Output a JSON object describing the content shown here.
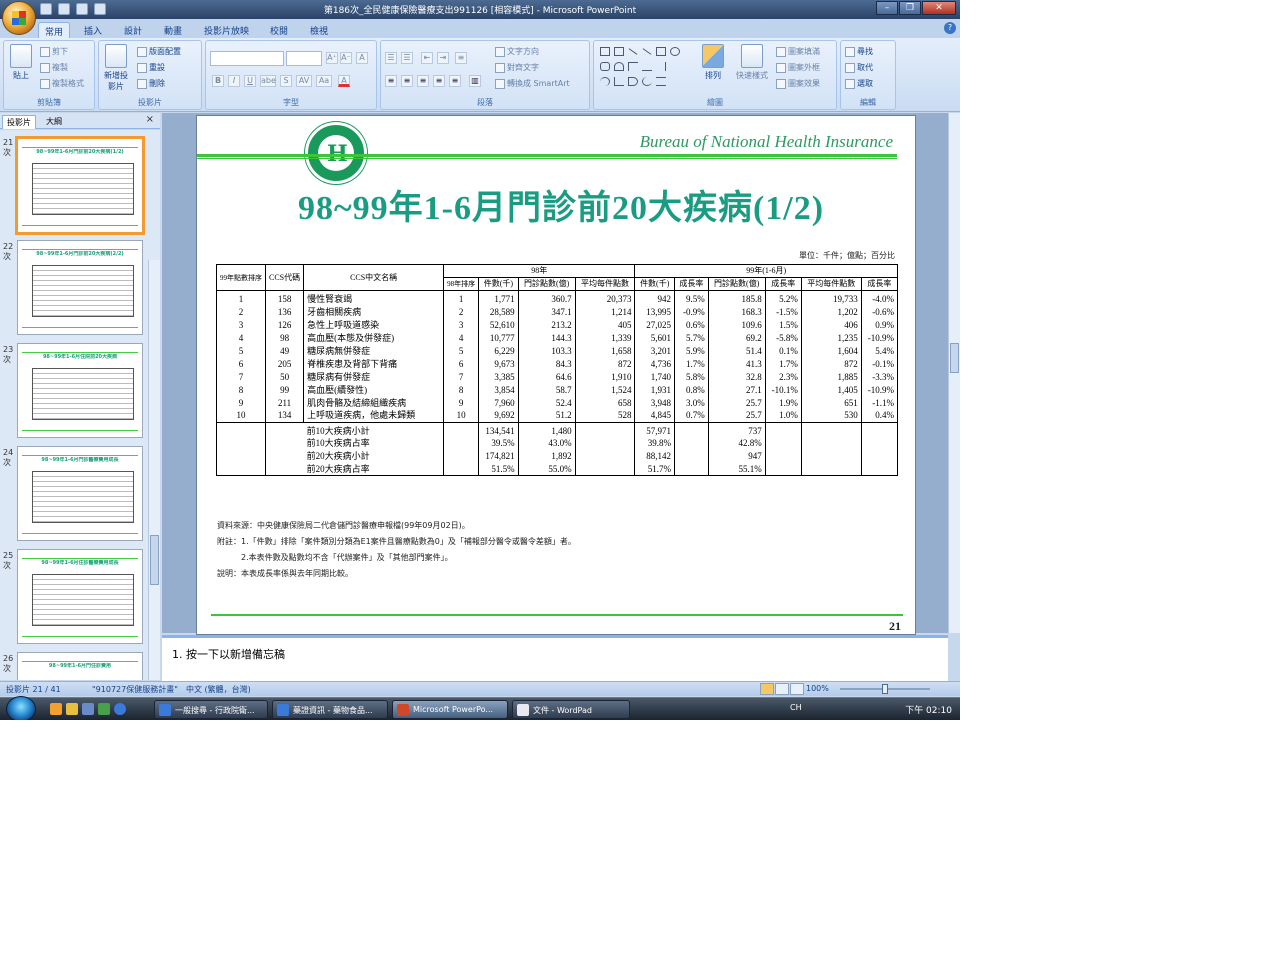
{
  "window": {
    "title": "第186次_全民健康保險醫療支出991126 [相容模式] - Microsoft PowerPoint"
  },
  "ribbon": {
    "tabs": [
      "常用",
      "插入",
      "設計",
      "動畫",
      "投影片放映",
      "校閱",
      "檢視"
    ],
    "active_tab": "常用",
    "clipboard": {
      "label": "剪貼簿",
      "paste": "貼上",
      "cut": "剪下",
      "copy": "複製",
      "format_painter": "複製格式"
    },
    "slides": {
      "label": "投影片",
      "new_slide": "新增投影片",
      "layout": "版面配置",
      "reset": "重設",
      "delete": "刪除"
    },
    "font": {
      "label": "字型",
      "bold": "B",
      "italic": "I",
      "underline": "U",
      "strike": "abe",
      "shadow": "S",
      "spacing": "AV",
      "case": "Aa",
      "grow": "A⁺",
      "shrink": "A⁻",
      "clear": "A"
    },
    "paragraph": {
      "label": "段落",
      "text_direction": "文字方向",
      "align_text": "對齊文字",
      "smartart": "轉換成 SmartArt"
    },
    "drawing": {
      "label": "繪圖",
      "arrange": "排列",
      "quick_styles": "快速樣式",
      "fill": "圖案填滿",
      "outline": "圖案外框",
      "effects": "圖案效果"
    },
    "editing": {
      "label": "編輯",
      "find": "尋找",
      "replace": "取代",
      "select": "選取"
    }
  },
  "left_pane": {
    "tabs": [
      "投影片",
      "大綱"
    ],
    "active_tab": "投影片",
    "close": "×",
    "suffix": "次",
    "thumbnails": [
      {
        "num": "21",
        "title": "98~99年1-6月門診前20大疾病(1/2)",
        "selected": true
      },
      {
        "num": "22",
        "title": "98~99年1-6月門診前20大疾病(2/2)",
        "selected": false
      },
      {
        "num": "23",
        "title": "98~99年1-6月住院前20大疾病",
        "selected": false
      },
      {
        "num": "24",
        "title": "98~99年1-6月門診醫療費用成長",
        "selected": false
      },
      {
        "num": "25",
        "title": "98~99年1-6月住診醫療費用成長",
        "selected": false
      },
      {
        "num": "26",
        "title": "98~99年1-6月門住診費用",
        "selected": false
      }
    ]
  },
  "slide": {
    "bureau": "Bureau of National Health Insurance",
    "title": "98~99年1-6月門診前20大疾病(1/2)",
    "unit": "單位：千件；億點；百分比",
    "number": "21",
    "headers": {
      "rank99": "99年點數排序",
      "ccs_code": "CCS代碼",
      "ccs_name": "CCS中文名稱",
      "y98": "98年",
      "y99": "99年(1-6月)",
      "rank98": "98年排序",
      "cases": "件數(千)",
      "points": "門診點數(億)",
      "avg": "平均每件點數",
      "growth": "成長率"
    },
    "rows": [
      [
        "1",
        "158",
        "慢性腎衰竭",
        "1",
        "1,771",
        "360.7",
        "20,373",
        "942",
        "9.5%",
        "185.8",
        "5.2%",
        "19,733",
        "-4.0%"
      ],
      [
        "2",
        "136",
        "牙齒相關疾病",
        "2",
        "28,589",
        "347.1",
        "1,214",
        "13,995",
        "-0.9%",
        "168.3",
        "-1.5%",
        "1,202",
        "-0.6%"
      ],
      [
        "3",
        "126",
        "急性上呼吸道感染",
        "3",
        "52,610",
        "213.2",
        "405",
        "27,025",
        "0.6%",
        "109.6",
        "1.5%",
        "406",
        "0.9%"
      ],
      [
        "4",
        "98",
        "高血壓(本態及併發症)",
        "4",
        "10,777",
        "144.3",
        "1,339",
        "5,601",
        "5.7%",
        "69.2",
        "-5.8%",
        "1,235",
        "-10.9%"
      ],
      [
        "5",
        "49",
        "糖尿病無併發症",
        "5",
        "6,229",
        "103.3",
        "1,658",
        "3,201",
        "5.9%",
        "51.4",
        "0.1%",
        "1,604",
        "5.4%"
      ],
      [
        "6",
        "205",
        "脊椎疾患及背部下背痛",
        "6",
        "9,673",
        "84.3",
        "872",
        "4,736",
        "1.7%",
        "41.3",
        "1.7%",
        "872",
        "-0.1%"
      ],
      [
        "7",
        "50",
        "糖尿病有併發症",
        "7",
        "3,385",
        "64.6",
        "1,910",
        "1,740",
        "5.8%",
        "32.8",
        "2.3%",
        "1,885",
        "-3.3%"
      ],
      [
        "8",
        "99",
        "高血壓(續發性)",
        "8",
        "3,854",
        "58.7",
        "1,524",
        "1,931",
        "0.8%",
        "27.1",
        "-10.1%",
        "1,405",
        "-10.9%"
      ],
      [
        "9",
        "211",
        "肌肉骨骼及結締組織疾病",
        "9",
        "7,960",
        "52.4",
        "658",
        "3,948",
        "3.0%",
        "25.7",
        "1.9%",
        "651",
        "-1.1%"
      ],
      [
        "10",
        "134",
        "上呼吸道疾病，他處未歸類",
        "10",
        "9,692",
        "51.2",
        "528",
        "4,845",
        "0.7%",
        "25.7",
        "1.0%",
        "530",
        "0.4%"
      ]
    ],
    "summary": [
      [
        "前10大疾病小計",
        "134,541",
        "1,480",
        "",
        "57,971",
        "",
        "737"
      ],
      [
        "前10大疾病占率",
        "39.5%",
        "43.0%",
        "",
        "39.8%",
        "",
        "42.8%"
      ],
      [
        "前20大疾病小計",
        "174,821",
        "1,892",
        "",
        "88,142",
        "",
        "947"
      ],
      [
        "前20大疾病占率",
        "51.5%",
        "55.0%",
        "",
        "51.7%",
        "",
        "55.1%"
      ]
    ],
    "notes": [
      "資料來源：中央健康保險局二代倉儲門診醫療申報檔(99年09月02日)。",
      "附註：1.「件數」排除「案件類別分類為E1案件且醫療點數為0」及「補報部分醫令或醫令差額」者。",
      "　　　2.本表件數及點數均不含「代辦案件」及「其他部門案件」。",
      "說明：本表成長率係與去年同期比較。"
    ]
  },
  "notes_pane": {
    "text": "1.  按一下以新增備忘稿"
  },
  "status": {
    "slide_count": "投影片 21 / 41",
    "theme": "\"910727保健服務計畫\"",
    "language": "中文 (繁體，台灣)",
    "zoom": "100%"
  },
  "taskbar": {
    "tasks": [
      {
        "label": "一般搜尋 - 行政院衛...",
        "active": false
      },
      {
        "label": "藥證資訊 - 藥物食品...",
        "active": false
      },
      {
        "label": "Microsoft PowerPo...",
        "active": true
      },
      {
        "label": "文件 - WordPad",
        "active": false
      }
    ],
    "tray": "CH",
    "clock": "下午 02:10"
  }
}
